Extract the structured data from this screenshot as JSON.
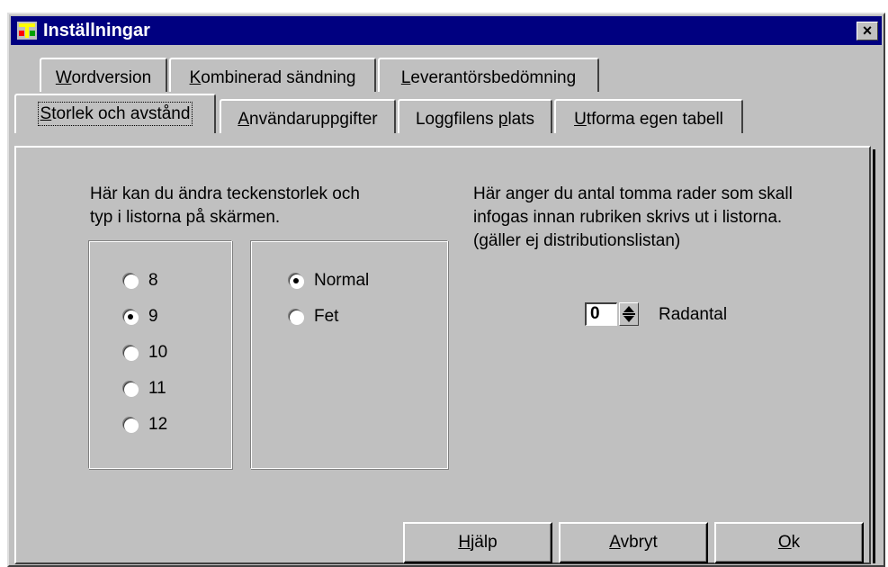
{
  "window": {
    "title": "Inställningar",
    "close_glyph": "×",
    "app_icon": "app-icon"
  },
  "tabs_back_row": [
    {
      "hotkey": "W",
      "rest": "ordversion"
    },
    {
      "hotkey": "K",
      "rest": "ombinerad sändning"
    },
    {
      "hotkey": "L",
      "rest": "everantörsbedömning"
    }
  ],
  "tabs_front_row": [
    {
      "hotkey": "S",
      "rest": "torlek och avstånd",
      "active": true
    },
    {
      "hotkey": "A",
      "rest": "nvändaruppgifter",
      "active": false
    },
    {
      "prefix": "Loggfilens ",
      "hotkey": "p",
      "rest": "lats",
      "active": false
    },
    {
      "hotkey": "U",
      "rest": "tforma egen tabell",
      "active": false
    }
  ],
  "font_section": {
    "description_line1": "Här kan du ändra teckenstorlek och",
    "description_line2": "typ i listorna på skärmen.",
    "sizes": [
      {
        "label": "8",
        "selected": false
      },
      {
        "label": "9",
        "selected": true
      },
      {
        "label": "10",
        "selected": false
      },
      {
        "label": "11",
        "selected": false
      },
      {
        "label": "12",
        "selected": false
      }
    ],
    "styles": [
      {
        "label": "Normal",
        "selected": true
      },
      {
        "label": "Fet",
        "selected": false
      }
    ]
  },
  "rows_section": {
    "description_line1": "Här anger du antal tomma rader som skall",
    "description_line2": "infogas innan rubriken skrivs ut i listorna.",
    "description_line3": "(gäller ej distributionslistan)",
    "value": "0",
    "label": "Radantal"
  },
  "buttons": {
    "help": {
      "hotkey": "H",
      "rest": "jälp"
    },
    "cancel": {
      "hotkey": "A",
      "rest": "vbryt"
    },
    "ok": {
      "hotkey": "O",
      "rest": "k"
    }
  },
  "colors": {
    "titlebar": "#000080",
    "face": "#c0c0c0"
  }
}
